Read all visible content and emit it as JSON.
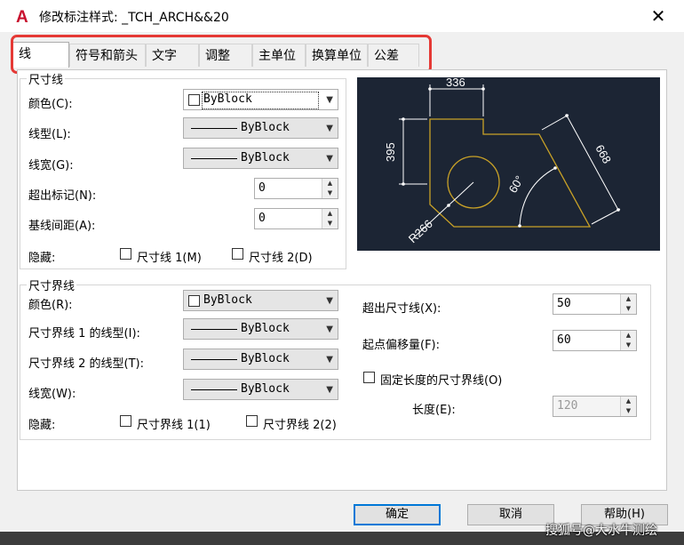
{
  "window": {
    "title": "修改标注样式: _TCH_ARCH&&20",
    "icon_letter": "A",
    "close_glyph": "✕"
  },
  "tabs": [
    {
      "label": "线",
      "active": true
    },
    {
      "label": "符号和箭头"
    },
    {
      "label": "文字"
    },
    {
      "label": "调整"
    },
    {
      "label": "主单位"
    },
    {
      "label": "换算单位"
    },
    {
      "label": "公差"
    }
  ],
  "dim_lines": {
    "group_title": "尺寸线",
    "color_label": "颜色(C):",
    "color_value": "ByBlock",
    "linetype_label": "线型(L):",
    "linetype_value": "ByBlock",
    "lineweight_label": "线宽(G):",
    "lineweight_value": "ByBlock",
    "extend_ticks_label": "超出标记(N):",
    "extend_ticks_value": "0",
    "baseline_spacing_label": "基线间距(A):",
    "baseline_spacing_value": "0",
    "suppress_label": "隐藏:",
    "suppress_1": "尺寸线 1(M)",
    "suppress_2": "尺寸线 2(D)"
  },
  "ext_lines": {
    "group_title": "尺寸界线",
    "color_label": "颜色(R):",
    "color_value": "ByBlock",
    "linetype1_label": "尺寸界线 1 的线型(I):",
    "linetype1_value": "ByBlock",
    "linetype2_label": "尺寸界线 2 的线型(T):",
    "linetype2_value": "ByBlock",
    "lineweight_label": "线宽(W):",
    "lineweight_value": "ByBlock",
    "suppress_label": "隐藏:",
    "suppress_1": "尺寸界线 1(1)",
    "suppress_2": "尺寸界线 2(2)",
    "extend_beyond_label": "超出尺寸线(X):",
    "extend_beyond_value": "50",
    "offset_origin_label": "起点偏移量(F):",
    "offset_origin_value": "60",
    "fixed_length_label": "固定长度的尺寸界线(O)",
    "length_label": "长度(E):",
    "length_value": "120"
  },
  "preview": {
    "dim_top": "336",
    "dim_left": "395",
    "dim_right": "668",
    "angle": "60°",
    "radius": "R266"
  },
  "buttons": {
    "ok": "确定",
    "cancel": "取消",
    "help": "帮助(H)"
  },
  "watermark": "搜狐号@大水牛测绘",
  "colors": {
    "preview_bg": "#1c2534",
    "geometry": "#c9a227",
    "dims": "#ffffff",
    "highlight": "#e53935",
    "accent": "#0078d7"
  }
}
